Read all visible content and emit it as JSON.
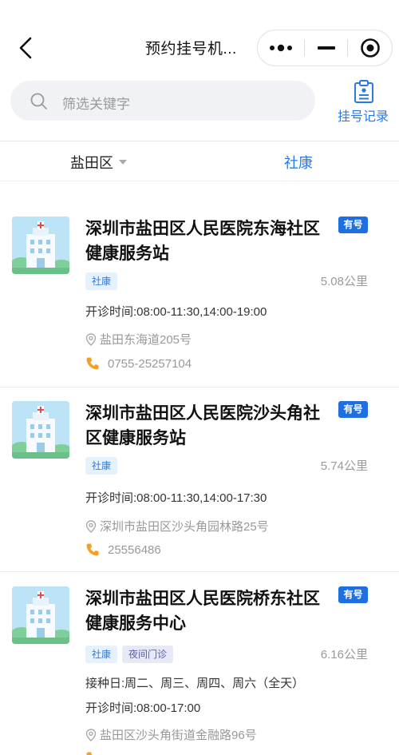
{
  "nav": {
    "title": "预约挂号机...",
    "back_icon": "chevron-left-icon",
    "menu_icon": "more-dots-icon",
    "minimize_icon": "minus-icon",
    "close_icon": "target-circle-icon"
  },
  "search": {
    "placeholder": "筛选关键字",
    "record_label": "挂号记录",
    "record_icon": "clipboard-icon"
  },
  "filters": {
    "district": "盐田区",
    "type": "社康"
  },
  "colors": {
    "accent": "#2a7ae4",
    "badge": "#1f6fe0",
    "phone": "#f5a023"
  },
  "facilities": [
    {
      "title": "深圳市盐田区人民医院东海社区健康服务站",
      "badge": "有号",
      "tags": [
        "社康"
      ],
      "distance": "5.08公里",
      "hours": "开诊时间:08:00-11:30,14:00-19:00",
      "address": "盐田东海道205号",
      "phone": "0755-25257104"
    },
    {
      "title": "深圳市盐田区人民医院沙头角社区健康服务站",
      "badge": "有号",
      "tags": [
        "社康"
      ],
      "distance": "5.74公里",
      "hours": "开诊时间:08:00-11:30,14:00-17:30",
      "address": "深圳市盐田区沙头角园林路25号",
      "phone": "25556486"
    },
    {
      "title": "深圳市盐田区人民医院桥东社区健康服务中心",
      "badge": "有号",
      "tags": [
        "社康",
        "夜间门诊"
      ],
      "distance": "6.16公里",
      "vaccine_days": "接种日:周二、周三、周四、周六（全天）",
      "hours": "开诊时间:08:00-17:00",
      "address": "盐田区沙头角街道金融路96号"
    }
  ]
}
